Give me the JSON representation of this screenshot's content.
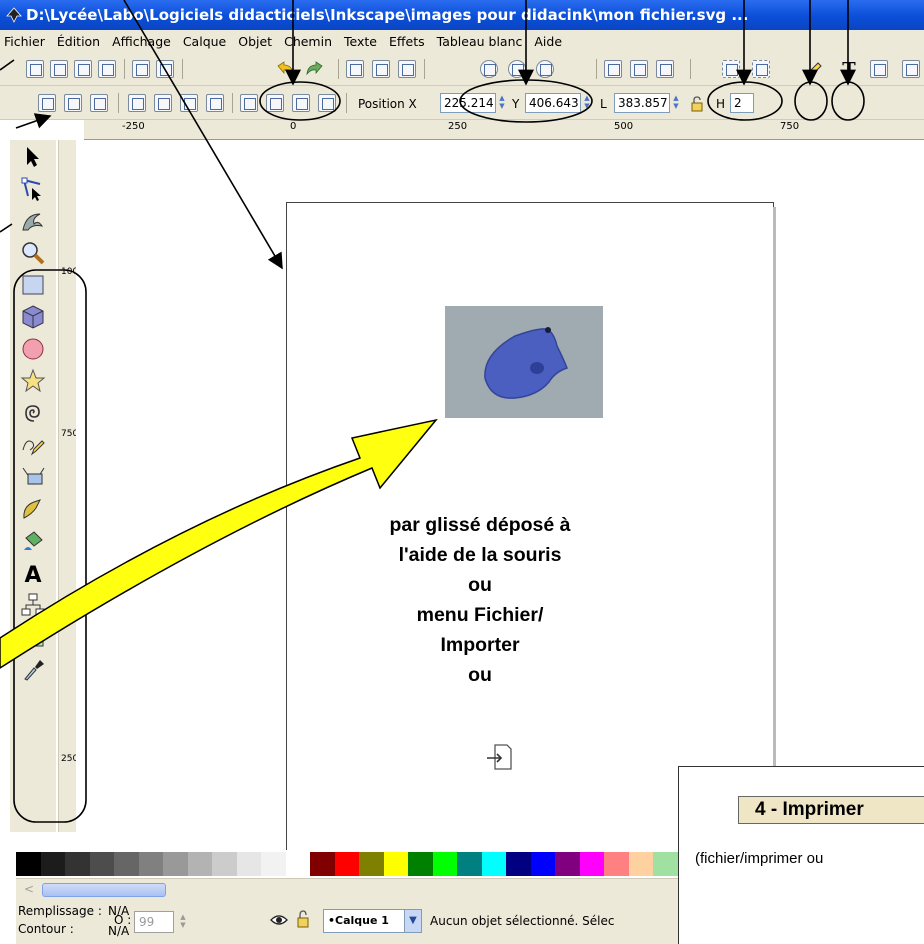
{
  "window": {
    "title": "D:\\Lycée\\Labo\\Logiciels didacticiels\\Inkscape\\images pour didacink\\mon fichier.svg ..."
  },
  "menu": [
    "Fichier",
    "Édition",
    "Affichage",
    "Calque",
    "Objet",
    "Chemin",
    "Texte",
    "Effets",
    "Tableau blanc",
    "Aide"
  ],
  "toolbar_icons": [
    "new-doc-icon",
    "open-icon",
    "save-icon",
    "print-icon",
    "import-icon",
    "export-icon",
    "undo-icon",
    "redo-icon",
    "duplicate-icon",
    "cut-icon",
    "paste-icon",
    "zoom-selection-icon",
    "zoom-drawing-icon",
    "zoom-page-icon",
    "group-icon",
    "ungroup-icon",
    "clone-icon",
    "xml-editor-icon",
    "text-font-icon",
    "fill-stroke-icon",
    "align-icon"
  ],
  "selector_bar": {
    "x_label": "Position X",
    "x_value": "225.214",
    "y_label": "Y",
    "y_value": "406.643",
    "w_label": "L",
    "w_value": "383.857",
    "h_label": "H",
    "h_value": "2"
  },
  "ruler": {
    "h_labels": [
      "-250",
      "0",
      "250",
      "500",
      "750"
    ],
    "v_labels": [
      "1000",
      "750",
      "250"
    ]
  },
  "tools": [
    "selector-tool-icon",
    "node-tool-icon",
    "tweak-tool-icon",
    "zoom-tool-icon",
    "rectangle-tool-icon",
    "3d-box-tool-icon",
    "ellipse-tool-icon",
    "star-tool-icon",
    "spiral-tool-icon",
    "pencil-tool-icon",
    "pen-tool-icon",
    "calligraphy-tool-icon",
    "paint-bucket-tool-icon",
    "text-tool-icon",
    "connector-tool-icon",
    "gradient-tool-icon",
    "dropper-tool-icon"
  ],
  "instructions": [
    "par glissé déposé à",
    "l'aide de la souris",
    "ou",
    "menu Fichier/",
    "Importer",
    "ou"
  ],
  "doc_box": {
    "heading": "4 - Imprimer",
    "text": "(fichier/imprimer ou"
  },
  "palette": [
    "#000000",
    "#1c1c1c",
    "#333333",
    "#4d4d4d",
    "#666666",
    "#808080",
    "#999999",
    "#b3b3b3",
    "#cccccc",
    "#e6e6e6",
    "#f2f2f2",
    "#ffffff",
    "#800000",
    "#ff0000",
    "#808000",
    "#ffff00",
    "#008000",
    "#00ff00",
    "#008080",
    "#00ffff",
    "#000080",
    "#0000ff",
    "#800080",
    "#ff00ff",
    "#ff8080",
    "#ffd0a0",
    "#a0e0a0"
  ],
  "status": {
    "fill_label": "Remplissage :",
    "fill_value": "N/A",
    "stroke_label": "Contour :",
    "stroke_value": "N/A",
    "opacity_label": "O :",
    "opacity_value": "99",
    "layer": "•Calque 1",
    "message": "Aucun objet sélectionné. Sélec"
  },
  "colors": {
    "title_bar": "#0b4fd8",
    "chrome": "#ece9d8",
    "annotation_arrow": "#ffff00"
  }
}
